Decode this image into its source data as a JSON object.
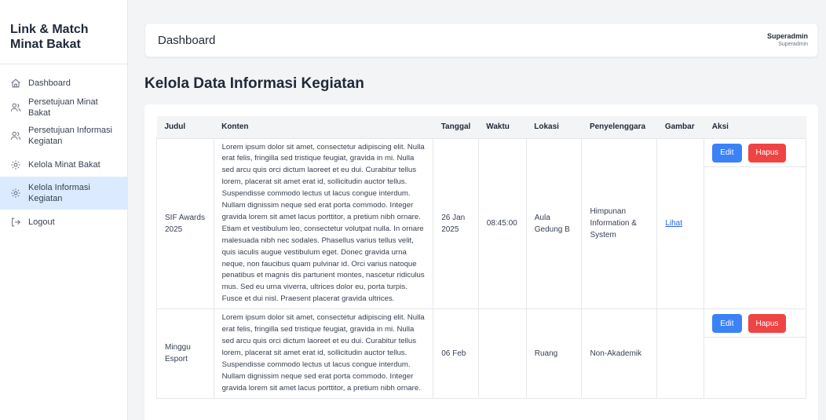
{
  "app": {
    "brand_line1": "Link & Match",
    "brand_line2": "Minat Bakat"
  },
  "sidebar": {
    "items": [
      {
        "label": "Dashboard",
        "icon": "home-icon"
      },
      {
        "label": "Persetujuan Minat Bakat",
        "icon": "users-icon"
      },
      {
        "label": "Persetujuan Informasi Kegiatan",
        "icon": "users-icon"
      },
      {
        "label": "Kelola Minat Bakat",
        "icon": "gear-icon"
      },
      {
        "label": "Kelola Informasi Kegiatan",
        "icon": "gear-icon",
        "active": true
      },
      {
        "label": "Logout",
        "icon": "logout-icon"
      }
    ]
  },
  "header": {
    "title": "Dashboard",
    "user_name": "Superadmin",
    "user_role": "Superadmin"
  },
  "main": {
    "heading": "Kelola Data Informasi Kegiatan",
    "table": {
      "columns": [
        "Judul",
        "Konten",
        "Tanggal",
        "Waktu",
        "Lokasi",
        "Penyelenggara",
        "Gambar",
        "Aksi"
      ],
      "edit_label": "Edit",
      "delete_label": "Hapus",
      "rows": [
        {
          "judul": "SIF Awards 2025",
          "konten": "Lorem ipsum dolor sit amet, consectetur adipiscing elit. Nulla erat felis, fringilla sed tristique feugiat, gravida in mi. Nulla sed arcu quis orci dictum laoreet et eu dui. Curabitur tellus lorem, placerat sit amet erat id, sollicitudin auctor tellus. Suspendisse commodo lectus ut lacus congue interdum. Nullam dignissim neque sed erat porta commodo. Integer gravida lorem sit amet lacus porttitor, a pretium nibh ornare. Etiam et vestibulum leo, consectetur volutpat nulla. In ornare malesuada nibh nec sodales. Phasellus varius tellus velit, quis iaculis augue vestibulum eget. Donec gravida urna neque, non faucibus quam pulvinar id. Orci varius natoque penatibus et magnis dis parturient montes, nascetur ridiculus mus. Sed eu urna viverra, ultrices dolor eu, porta turpis. Fusce et dui nisl. Praesent placerat gravida ultrices.",
          "tanggal": "26 Jan 2025",
          "waktu": "08:45:00",
          "lokasi": "Aula Gedung B",
          "penyelenggara": "Himpunan Information & System",
          "gambar": "Lihat"
        },
        {
          "judul": "Minggu Esport",
          "konten": "Lorem ipsum dolor sit amet, consectetur adipiscing elit. Nulla erat felis, fringilla sed tristique feugiat, gravida in mi. Nulla sed arcu quis orci dictum laoreet et eu dui. Curabitur tellus lorem, placerat sit amet erat id, sollicitudin auctor tellus. Suspendisse commodo lectus ut lacus congue interdum. Nullam dignissim neque sed erat porta commodo. Integer gravida lorem sit amet lacus porttitor, a pretium nibh ornare.",
          "tanggal": "06 Feb",
          "waktu": "",
          "lokasi": "Ruang",
          "penyelenggara": "Non-Akademik",
          "gambar": ""
        }
      ]
    }
  },
  "colors": {
    "accent": "#3b82f6",
    "danger": "#ef4444",
    "active_bg": "#dbeafe",
    "link": "#2563eb"
  }
}
